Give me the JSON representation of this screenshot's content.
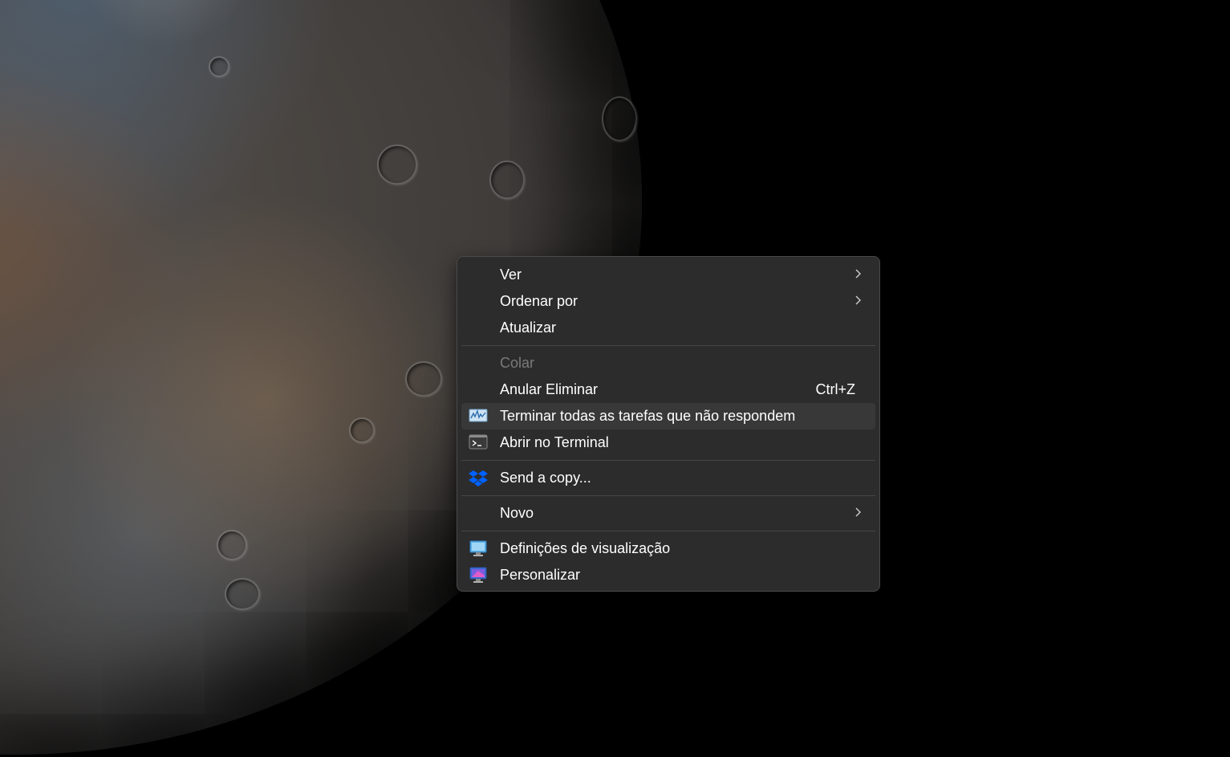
{
  "context_menu": {
    "items": [
      {
        "label": "Ver",
        "submenu": true
      },
      {
        "label": "Ordenar por",
        "submenu": true
      },
      {
        "label": "Atualizar"
      },
      {
        "label": "Colar",
        "disabled": true
      },
      {
        "label": "Anular Eliminar",
        "shortcut": "Ctrl+Z"
      },
      {
        "label": "Terminar todas as tarefas que não respondem",
        "icon": "task-monitor-icon",
        "highlighted": true
      },
      {
        "label": "Abrir no Terminal",
        "icon": "terminal-icon"
      },
      {
        "label": "Send a copy...",
        "icon": "dropbox-icon"
      },
      {
        "label": "Novo",
        "submenu": true
      },
      {
        "label": "Definições de visualização",
        "icon": "display-settings-icon"
      },
      {
        "label": "Personalizar",
        "icon": "personalize-icon"
      }
    ]
  },
  "colors": {
    "menu_background": "#2c2c2c",
    "menu_border": "#4a4a4a",
    "highlight": "#383838",
    "text": "#ffffff",
    "disabled_text": "#7a7a7a",
    "dropbox_blue": "#0061fe"
  }
}
